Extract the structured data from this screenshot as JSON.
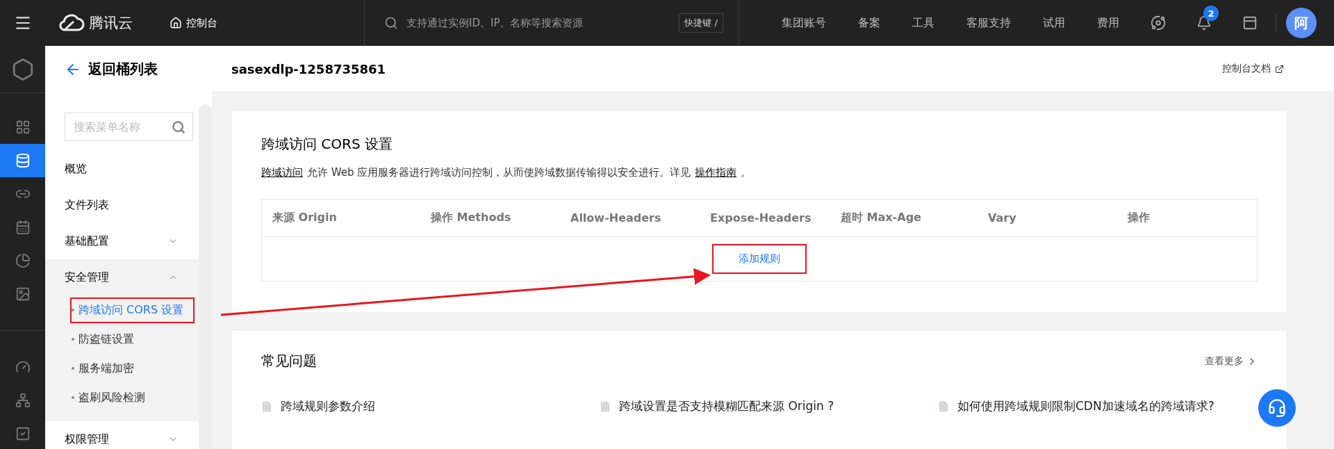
{
  "topbar": {
    "brand": "腾讯云",
    "console": "控制台",
    "search": {
      "placeholder": "支持通过实例ID、IP、名称等搜索资源"
    },
    "shortcut": "快捷键 /",
    "nav": [
      "集团账号",
      "备案",
      "工具",
      "客服支持",
      "试用",
      "费用"
    ],
    "notifications": "2",
    "avatar": "阿"
  },
  "rail": {
    "top": {
      "kind": "box"
    },
    "groups": [
      [
        {
          "kind": "grid",
          "selected": false
        },
        {
          "kind": "database",
          "selected": true
        },
        {
          "kind": "link",
          "selected": false
        },
        {
          "kind": "calendar",
          "selected": false
        },
        {
          "kind": "pie",
          "selected": false
        },
        {
          "kind": "image",
          "selected": false
        }
      ],
      [
        {
          "kind": "gauge",
          "selected": false
        },
        {
          "kind": "tree",
          "selected": false
        },
        {
          "kind": "check",
          "selected": false
        }
      ]
    ]
  },
  "sidebar": {
    "back": "返回桶列表",
    "search": {
      "placeholder": "搜索菜单名称"
    },
    "items": [
      {
        "label": "概览",
        "kind": "link"
      },
      {
        "label": "文件列表",
        "kind": "link"
      },
      {
        "label": "基础配置",
        "kind": "group",
        "expanded": false
      },
      {
        "label": "安全管理",
        "kind": "group",
        "expanded": true,
        "children": [
          {
            "label": "跨域访问 CORS 设置",
            "selected": true,
            "highlighted": true
          },
          {
            "label": "防盗链设置",
            "selected": false,
            "highlighted": false
          },
          {
            "label": "服务端加密",
            "selected": false,
            "highlighted": false
          },
          {
            "label": "盗刷风险检测",
            "selected": false,
            "highlighted": false
          }
        ]
      },
      {
        "label": "权限管理",
        "kind": "group",
        "expanded": false
      }
    ]
  },
  "header": {
    "title": "sasexdlp-1258735861",
    "doc_link": "控制台文档"
  },
  "cors": {
    "title": "跨域访问 CORS 设置",
    "description": [
      {
        "kind": "link",
        "text": "跨域访问"
      },
      {
        "kind": "text",
        "text": "允许 Web 应用服务器进行跨域访问控制，从而使跨域数据传输得以安全进行。详见"
      },
      {
        "kind": "link",
        "text": "操作指南"
      },
      {
        "kind": "text",
        "text": "。"
      }
    ],
    "columns": [
      "来源 Origin",
      "操作 Methods",
      "Allow-Headers",
      "Expose-Headers",
      "超时 Max-Age",
      "Vary",
      "操作"
    ],
    "add_button": {
      "label": "添加规则",
      "highlighted": true
    }
  },
  "faq": {
    "title": "常见问题",
    "more": "查看更多",
    "articles": [
      "跨域规则参数介绍",
      "跨域设置是否支持模糊匹配来源 Origin ?",
      "如何使用跨域规则限制CDN加速域名的跨域请求?"
    ]
  }
}
